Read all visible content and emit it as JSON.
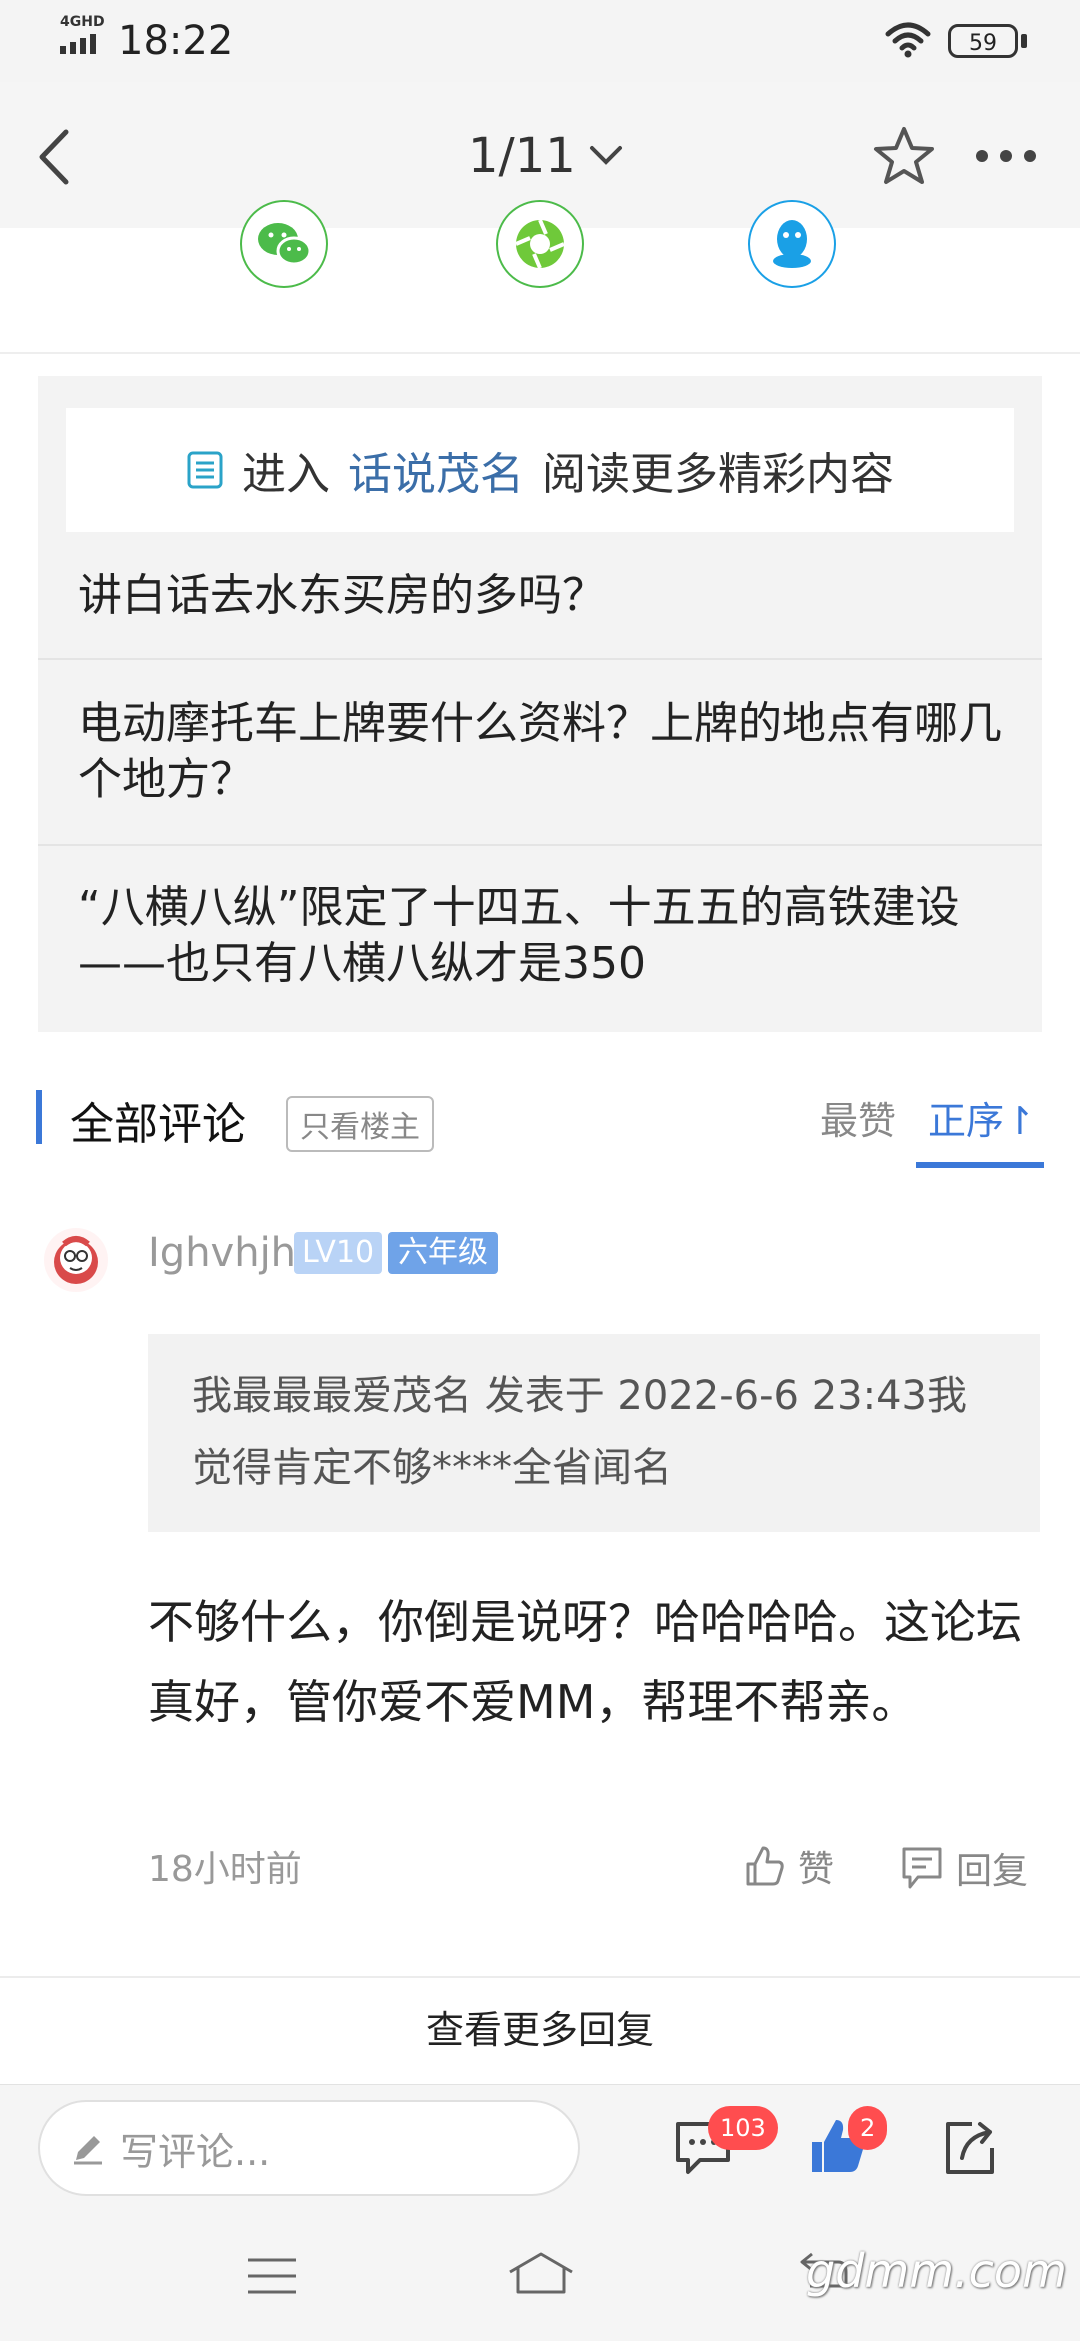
{
  "status_bar": {
    "network": "4GHD",
    "time": "18:22",
    "battery": "59"
  },
  "header": {
    "page_indicator": "1/11"
  },
  "share": {
    "icons": [
      "wechat-icon",
      "moments-icon",
      "qq-icon"
    ]
  },
  "related": {
    "enter_prefix": "进入",
    "forum_link": "话说茂名",
    "enter_suffix": "阅读更多精彩内容",
    "items": [
      "讲白话去水东买房的多吗？",
      "电动摩托车上牌要什么资料？上牌的地点有哪几个地方？",
      "“八横八纵”限定了十四五、十五五的高铁建设——也只有八横八纵才是350"
    ]
  },
  "comments": {
    "title": "全部评论",
    "only_owner": "只看楼主",
    "sort_best": "最赞",
    "sort_order": "正序↾",
    "items": [
      {
        "username": "Ighvhjh",
        "level": "LV10",
        "grade": "六年级",
        "quote": "我最最最爱茂名 发表于 2022-6-6 23:43我觉得肯定不够****全省闻名",
        "body": "不够什么，你倒是说呀？哈哈哈哈。这论坛真好，管你爱不爱MM，帮理不帮亲。",
        "time": "18小时前",
        "like_label": "赞",
        "reply_label": "回复"
      }
    ],
    "view_more": "查看更多回复"
  },
  "bottom_bar": {
    "write_placeholder": "写评论...",
    "comment_count": "103",
    "like_count": "2"
  },
  "watermark": "gdmm.com",
  "colors": {
    "accent": "#3b78d8",
    "link": "#3b6ea8",
    "badge": "#ff4d4f",
    "wechat": "#4cbb4a",
    "qq": "#1aa0e6"
  }
}
